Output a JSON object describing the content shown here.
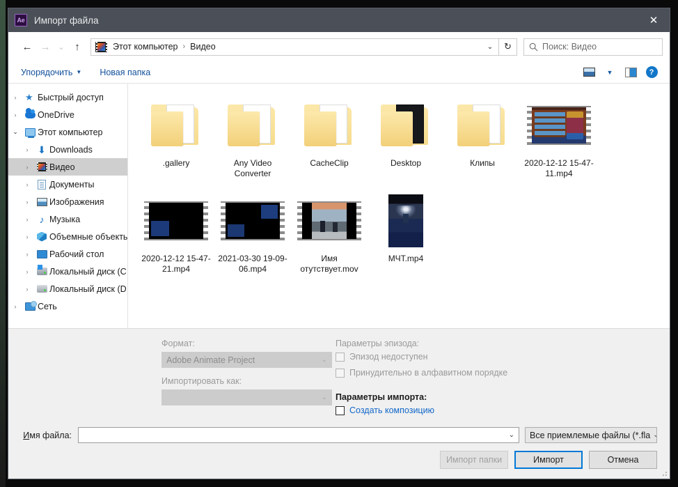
{
  "window": {
    "app_icon_label": "Ae",
    "title": "Импорт файла",
    "close_label": "✕"
  },
  "nav": {
    "back_icon": "arrow-left",
    "forward_icon": "arrow-right",
    "recent_icon": "chevron-down",
    "up_icon": "arrow-up",
    "breadcrumb": [
      "Этот компьютер",
      "Видео"
    ],
    "breadcrumb_separator": "›",
    "dropdown_caret": "⌄",
    "refresh_icon": "↻",
    "search_placeholder": "Поиск: Видео"
  },
  "toolbar": {
    "organize_label": "Упорядочить",
    "organize_caret": "▼",
    "new_folder_label": "Новая папка",
    "view_icon": "view-mode-icon",
    "view_caret": "▼",
    "preview_pane_icon": "preview-pane-icon",
    "help_label": "?"
  },
  "sidebar": {
    "items": [
      {
        "label": "Быстрый доступ",
        "icon": "star-icon",
        "level": 1,
        "expandable": true,
        "expanded": false,
        "selected": false
      },
      {
        "label": "OneDrive",
        "icon": "cloud-icon",
        "level": 1,
        "expandable": true,
        "expanded": false,
        "selected": false
      },
      {
        "label": "Этот компьютер",
        "icon": "computer-icon",
        "level": 1,
        "expandable": true,
        "expanded": true,
        "selected": false
      },
      {
        "label": "Downloads",
        "icon": "download-icon",
        "level": 2,
        "expandable": true,
        "expanded": false,
        "selected": false
      },
      {
        "label": "Видео",
        "icon": "video-icon",
        "level": 2,
        "expandable": true,
        "expanded": false,
        "selected": true
      },
      {
        "label": "Документы",
        "icon": "document-icon",
        "level": 2,
        "expandable": true,
        "expanded": false,
        "selected": false
      },
      {
        "label": "Изображения",
        "icon": "pictures-icon",
        "level": 2,
        "expandable": true,
        "expanded": false,
        "selected": false
      },
      {
        "label": "Музыка",
        "icon": "music-icon",
        "level": 2,
        "expandable": true,
        "expanded": false,
        "selected": false
      },
      {
        "label": "Объемные объекты",
        "icon": "3d-objects-icon",
        "level": 2,
        "expandable": true,
        "expanded": false,
        "selected": false
      },
      {
        "label": "Рабочий стол",
        "icon": "desktop-icon",
        "level": 2,
        "expandable": true,
        "expanded": false,
        "selected": false
      },
      {
        "label": "Локальный диск (C",
        "icon": "windows-disk-icon",
        "level": 2,
        "expandable": true,
        "expanded": false,
        "selected": false
      },
      {
        "label": "Локальный диск (D",
        "icon": "disk-icon",
        "level": 2,
        "expandable": true,
        "expanded": false,
        "selected": false
      },
      {
        "label": "Сеть",
        "icon": "network-icon",
        "level": 1,
        "expandable": true,
        "expanded": false,
        "selected": false
      }
    ]
  },
  "files": [
    {
      "name": ".gallery",
      "kind": "folder",
      "preview": "photo"
    },
    {
      "name": "Any Video Converter",
      "kind": "folder",
      "preview": "photo"
    },
    {
      "name": "CacheClip",
      "kind": "folder",
      "preview": "photo"
    },
    {
      "name": "Desktop",
      "kind": "folder",
      "preview": "dark"
    },
    {
      "name": "Клипы",
      "kind": "folder",
      "preview": "document"
    },
    {
      "name": "2020-12-12 15-47-11.mp4",
      "kind": "video",
      "preview": "game",
      "orientation": "landscape"
    },
    {
      "name": "2020-12-12 15-47-21.mp4",
      "kind": "video",
      "preview": "black",
      "orientation": "landscape"
    },
    {
      "name": "2021-03-30 19-09-06.mp4",
      "kind": "video",
      "preview": "black2",
      "orientation": "landscape"
    },
    {
      "name": "Имя отутствует.mov",
      "kind": "video",
      "preview": "street",
      "orientation": "landscape"
    },
    {
      "name": "МЧТ.mp4",
      "kind": "video",
      "preview": "concert",
      "orientation": "portrait"
    }
  ],
  "options": {
    "format_label": "Формат:",
    "format_value": "Adobe Animate Project",
    "import_as_label": "Импортировать как:",
    "import_as_value": "",
    "episode_params_label": "Параметры эпизода:",
    "episode_checkboxes": [
      {
        "label": "Эпизод недоступен",
        "checked": false,
        "enabled": false
      },
      {
        "label": "Принудительно в алфавитном порядке",
        "checked": false,
        "enabled": false
      }
    ],
    "import_params_label": "Параметры импорта:",
    "import_checkboxes": [
      {
        "label": "Создать композицию",
        "checked": false,
        "enabled": true
      }
    ],
    "dropdown_caret": "⌄"
  },
  "footer": {
    "filename_label_prefix": "И",
    "filename_label_rest": "мя файла:",
    "filename_value": "",
    "filename_caret": "⌄",
    "filter_value": "Все приемлемые файлы (*.fla",
    "filter_caret": "⌄",
    "buttons": [
      {
        "label": "Импорт папки",
        "state": "disabled"
      },
      {
        "label": "Импорт",
        "state": "default"
      },
      {
        "label": "Отмена",
        "state": "normal"
      }
    ]
  },
  "colors": {
    "titlebar_bg": "#4b5058",
    "accent_blue": "#0078d7",
    "link_blue": "#1267c8",
    "panel_bg": "#f0f0f0",
    "selection_gray": "#cfcfcf"
  }
}
